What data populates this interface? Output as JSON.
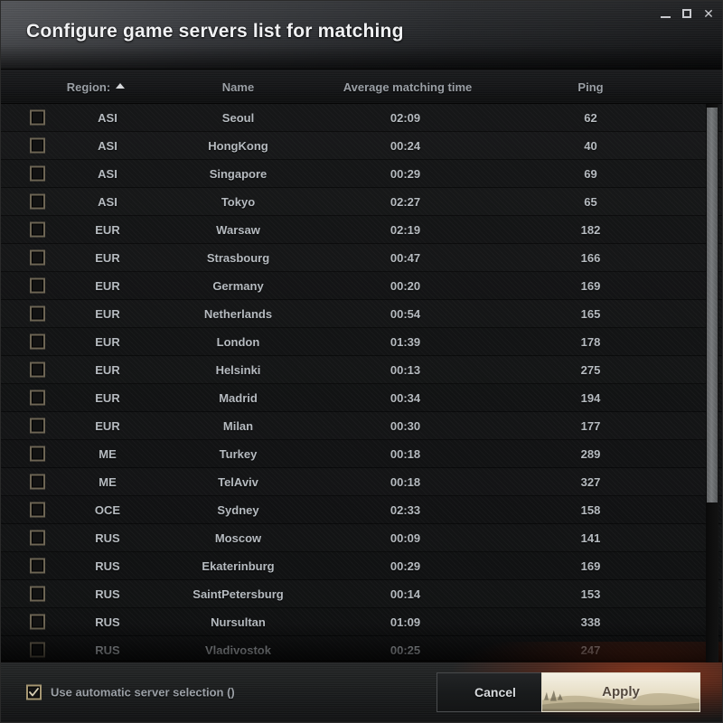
{
  "window": {
    "title": "Configure game servers list for matching",
    "controls": {
      "minimize": "–",
      "maximize": "□",
      "close": "✕"
    }
  },
  "table": {
    "columns": {
      "region": "Region:",
      "name": "Name",
      "time": "Average matching time",
      "ping": "Ping"
    },
    "sort": {
      "column": "Region:",
      "direction": "ascending",
      "indicator": "caret-up-icon"
    },
    "rows": [
      {
        "checked": false,
        "region": "ASI",
        "name": "Seoul",
        "time": "02:09",
        "ping": "62"
      },
      {
        "checked": false,
        "region": "ASI",
        "name": "HongKong",
        "time": "00:24",
        "ping": "40"
      },
      {
        "checked": false,
        "region": "ASI",
        "name": "Singapore",
        "time": "00:29",
        "ping": "69"
      },
      {
        "checked": false,
        "region": "ASI",
        "name": "Tokyo",
        "time": "02:27",
        "ping": "65"
      },
      {
        "checked": false,
        "region": "EUR",
        "name": "Warsaw",
        "time": "02:19",
        "ping": "182"
      },
      {
        "checked": false,
        "region": "EUR",
        "name": "Strasbourg",
        "time": "00:47",
        "ping": "166"
      },
      {
        "checked": false,
        "region": "EUR",
        "name": "Germany",
        "time": "00:20",
        "ping": "169"
      },
      {
        "checked": false,
        "region": "EUR",
        "name": "Netherlands",
        "time": "00:54",
        "ping": "165"
      },
      {
        "checked": false,
        "region": "EUR",
        "name": "London",
        "time": "01:39",
        "ping": "178"
      },
      {
        "checked": false,
        "region": "EUR",
        "name": "Helsinki",
        "time": "00:13",
        "ping": "275"
      },
      {
        "checked": false,
        "region": "EUR",
        "name": "Madrid",
        "time": "00:34",
        "ping": "194"
      },
      {
        "checked": false,
        "region": "EUR",
        "name": "Milan",
        "time": "00:30",
        "ping": "177"
      },
      {
        "checked": false,
        "region": "ME",
        "name": "Turkey",
        "time": "00:18",
        "ping": "289"
      },
      {
        "checked": false,
        "region": "ME",
        "name": "TelAviv",
        "time": "00:18",
        "ping": "327"
      },
      {
        "checked": false,
        "region": "OCE",
        "name": "Sydney",
        "time": "02:33",
        "ping": "158"
      },
      {
        "checked": false,
        "region": "RUS",
        "name": "Moscow",
        "time": "00:09",
        "ping": "141"
      },
      {
        "checked": false,
        "region": "RUS",
        "name": "Ekaterinburg",
        "time": "00:29",
        "ping": "169"
      },
      {
        "checked": false,
        "region": "RUS",
        "name": "SaintPetersburg",
        "time": "00:14",
        "ping": "153"
      },
      {
        "checked": false,
        "region": "RUS",
        "name": "Nursultan",
        "time": "01:09",
        "ping": "338"
      },
      {
        "checked": false,
        "region": "RUS",
        "name": "Vladivostok",
        "time": "00:25",
        "ping": "247"
      }
    ]
  },
  "scrollbar": {
    "thumb_top_pct": 0.6,
    "thumb_height_pct": 70.7
  },
  "footer": {
    "auto_select_label": "Use automatic server selection ()",
    "auto_select_checked": true,
    "cancel_label": "Cancel",
    "apply_label": "Apply"
  },
  "colors": {
    "accent_warm": "#c43e16",
    "checkbox_border": "#6d6554",
    "checkbox_checked_border": "#a59672",
    "text_primary": "#b6bbc0",
    "text_header": "#9ba0a6",
    "title_text": "#f1f2f4"
  }
}
